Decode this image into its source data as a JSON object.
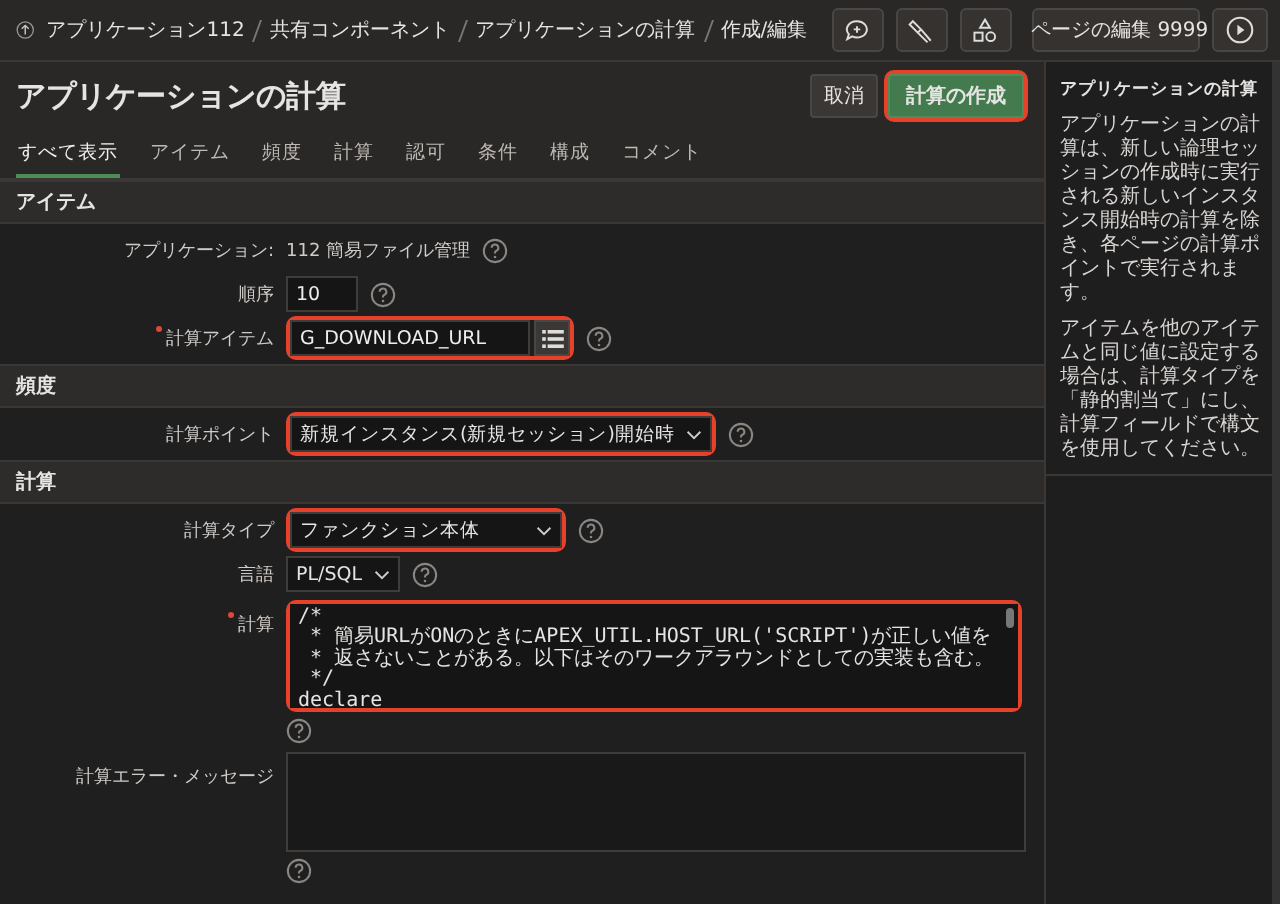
{
  "breadcrumb": [
    "アプリケーション112",
    "共有コンポーネント",
    "アプリケーションの計算",
    "作成/編集"
  ],
  "toolbar": {
    "edit_page": "ページの編集 9999"
  },
  "title": "アプリケーションの計算",
  "buttons": [
    {
      "label": "取消",
      "kind": "plain",
      "highlighted": false
    },
    {
      "label": "計算の作成",
      "kind": "primary",
      "highlighted": true
    }
  ],
  "tabs": [
    {
      "label": "すべて表示",
      "selected": true
    },
    {
      "label": "アイテム",
      "selected": false
    },
    {
      "label": "頻度",
      "selected": false
    },
    {
      "label": "計算",
      "selected": false
    },
    {
      "label": "認可",
      "selected": false
    },
    {
      "label": "条件",
      "selected": false
    },
    {
      "label": "構成",
      "selected": false
    },
    {
      "label": "コメント",
      "selected": false
    }
  ],
  "sections": [
    {
      "title": "アイテム",
      "fields": [
        {
          "kind": "static",
          "label": "アプリケーション:",
          "value": "112 簡易ファイル管理",
          "required": false,
          "highlighted": false
        },
        {
          "kind": "text",
          "label": "順序",
          "value": "10",
          "required": false,
          "highlighted": false
        },
        {
          "kind": "popup",
          "label": "計算アイテム",
          "value": "G_DOWNLOAD_URL",
          "required": true,
          "highlighted": true
        }
      ]
    },
    {
      "title": "頻度",
      "fields": [
        {
          "kind": "select",
          "label": "計算ポイント",
          "value": "新規インスタンス(新規セッション)開始時",
          "required": false,
          "highlighted": true
        }
      ]
    },
    {
      "title": "計算",
      "fields": [
        {
          "kind": "wide-select",
          "label": "計算タイプ",
          "value": "ファンクション本体",
          "required": false,
          "highlighted": true
        },
        {
          "kind": "select",
          "label": "言語",
          "value": "PL/SQL",
          "required": false,
          "highlighted": false
        },
        {
          "kind": "code",
          "label": "計算",
          "lines": [
            "/*",
            " * 簡易URLがONのときにAPEX_UTIL.HOST_URL('SCRIPT')が正しい値を",
            " * 返さないことがある。以下はそのワークアラウンドとしての実装も含む。",
            " */",
            "declare"
          ],
          "required": true,
          "highlighted": true
        },
        {
          "kind": "textarea",
          "label": "計算エラー・メッセージ",
          "required": false,
          "highlighted": false
        }
      ]
    }
  ],
  "help": {
    "title": "アプリケーションの計算",
    "paragraphs": [
      "アプリケーションの計算は、新しい論理セッションの作成時に実行される新しいインスタンス開始時の計算を除き、各ページの計算ポイントで実行されます。",
      "アイテムを他のアイテムと同じ値に設定する場合は、計算タイプを「静的割当て」にし、計算フィールドで構文を使用してください。"
    ]
  }
}
